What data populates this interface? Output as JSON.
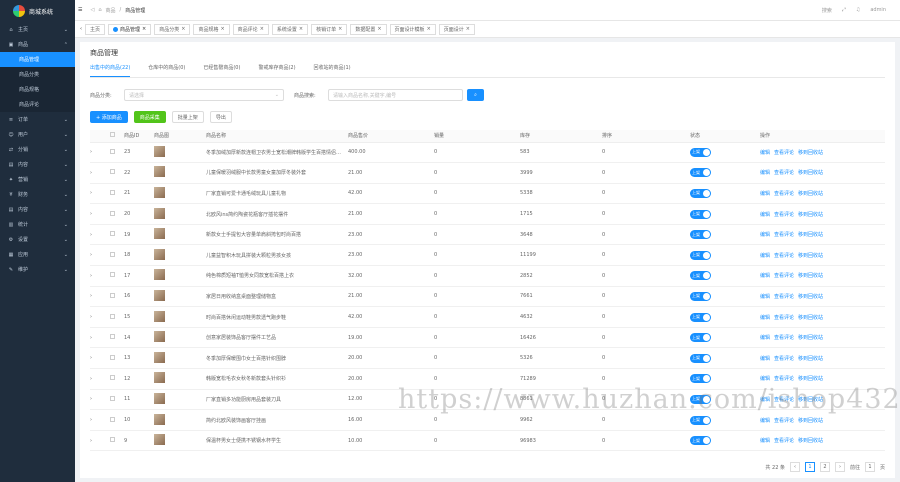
{
  "app": {
    "logo_text": "商城系统"
  },
  "sidebar": {
    "items": [
      {
        "label": "主页",
        "icon": "home-icon",
        "expanded": false
      },
      {
        "label": "商品",
        "icon": "goods-icon",
        "expanded": true
      },
      {
        "label": "商品管理",
        "sub": true,
        "active": true
      },
      {
        "label": "商品分类",
        "sub": true
      },
      {
        "label": "商品规格",
        "sub": true
      },
      {
        "label": "商品评论",
        "sub": true
      },
      {
        "label": "订单",
        "icon": "order-icon"
      },
      {
        "label": "用户",
        "icon": "user-icon"
      },
      {
        "label": "分销",
        "icon": "share-icon"
      },
      {
        "label": "内容",
        "icon": "content-icon"
      },
      {
        "label": "营销",
        "icon": "marketing-icon"
      },
      {
        "label": "财务",
        "icon": "finance-icon"
      },
      {
        "label": "内容",
        "icon": "content-icon"
      },
      {
        "label": "统计",
        "icon": "stats-icon"
      },
      {
        "label": "设置",
        "icon": "settings-icon"
      },
      {
        "label": "应用",
        "icon": "app-icon"
      },
      {
        "label": "维护",
        "icon": "tool-icon"
      }
    ]
  },
  "topbar": {
    "crumb_parent": "商品",
    "crumb_current": "商品管理",
    "search": "搜索",
    "user": "admin"
  },
  "tabs": [
    "主页",
    "商品管理",
    "商品分类",
    "商品规格",
    "商品评论",
    "系统设置",
    "核销订单",
    "数据配置",
    "页面设计模板",
    "页面设计"
  ],
  "page": {
    "title": "商品管理"
  },
  "subtabs": [
    "出售中的商品(22)",
    "仓库中的商品(0)",
    "已经售罄商品(0)",
    "警戒库存商品(2)",
    "回收站的商品(1)"
  ],
  "filters": {
    "category_label": "商品分类:",
    "category_placeholder": "请选择",
    "search_label": "商品搜索:",
    "search_placeholder": "请输入商品名称,关键字,编号"
  },
  "actions": {
    "add": "+ 添加商品",
    "collect": "商品采集",
    "batch": "批量上架",
    "export": "导出"
  },
  "table": {
    "headers": [
      "",
      "",
      "商品ID",
      "商品图",
      "商品名称",
      "商品售价",
      "销量",
      "库存",
      "排序",
      "状态",
      "操作"
    ],
    "status_on": "上架",
    "op_edit": "编辑",
    "op_view": "查看评论",
    "op_recycle": "移到回收站",
    "rows": [
      {
        "id": "23",
        "name": "冬季加绒加厚新款连帽卫衣男士宽松潮牌韩版学生百搭情侣外套",
        "price": "400.00",
        "sales": "0",
        "stock": "583",
        "sort": "0"
      },
      {
        "id": "22",
        "name": "儿童保暖羽绒服中长款男童女童加厚冬装外套",
        "price": "21.00",
        "sales": "0",
        "stock": "3999",
        "sort": "0"
      },
      {
        "id": "21",
        "name": "厂家直销可爱卡通毛绒玩具儿童礼物",
        "price": "42.00",
        "sales": "0",
        "stock": "5338",
        "sort": "0"
      },
      {
        "id": "20",
        "name": "北欧风ins简约陶瓷花瓶客厅插花摆件",
        "price": "21.00",
        "sales": "0",
        "stock": "1715",
        "sort": "0"
      },
      {
        "id": "19",
        "name": "新款女士手提包大容量单肩斜挎包时尚百搭",
        "price": "23.00",
        "sales": "0",
        "stock": "3648",
        "sort": "0"
      },
      {
        "id": "18",
        "name": "儿童益智积木玩具拼装大颗粒男孩女孩",
        "price": "23.00",
        "sales": "0",
        "stock": "11199",
        "sort": "0"
      },
      {
        "id": "17",
        "name": "纯色棉质短袖T恤男女同款宽松百搭上衣",
        "price": "32.00",
        "sales": "0",
        "stock": "2852",
        "sort": "0"
      },
      {
        "id": "16",
        "name": "家居日用收纳盒桌面整理储物盒",
        "price": "21.00",
        "sales": "0",
        "stock": "7661",
        "sort": "0"
      },
      {
        "id": "15",
        "name": "时尚百搭休闲运动鞋男款透气跑步鞋",
        "price": "42.00",
        "sales": "0",
        "stock": "4632",
        "sort": "0"
      },
      {
        "id": "14",
        "name": "创意家居装饰品客厅摆件工艺品",
        "price": "19.00",
        "sales": "0",
        "stock": "16426",
        "sort": "0"
      },
      {
        "id": "13",
        "name": "冬季加厚保暖围巾女士百搭针织围脖",
        "price": "20.00",
        "sales": "0",
        "stock": "5326",
        "sort": "0"
      },
      {
        "id": "12",
        "name": "韩版宽松毛衣女秋冬新款套头针织衫",
        "price": "20.00",
        "sales": "0",
        "stock": "71289",
        "sort": "0"
      },
      {
        "id": "11",
        "name": "厂家直销多功能厨房用品套装刀具",
        "price": "12.00",
        "sales": "0",
        "stock": "8861",
        "sort": "0"
      },
      {
        "id": "10",
        "name": "简约北欧风装饰画客厅挂画",
        "price": "16.00",
        "sales": "0",
        "stock": "9962",
        "sort": "0"
      },
      {
        "id": "9",
        "name": "保温杯男女士便携不锈钢水杯学生",
        "price": "10.00",
        "sales": "0",
        "stock": "96983",
        "sort": "0"
      }
    ]
  },
  "pager": {
    "total": "共 22 条",
    "pages": [
      "1",
      "2"
    ],
    "goto": "前往",
    "page_input": "1",
    "page_unit": "页"
  },
  "watermark": "https://www.huzhan.com/ishop43295"
}
